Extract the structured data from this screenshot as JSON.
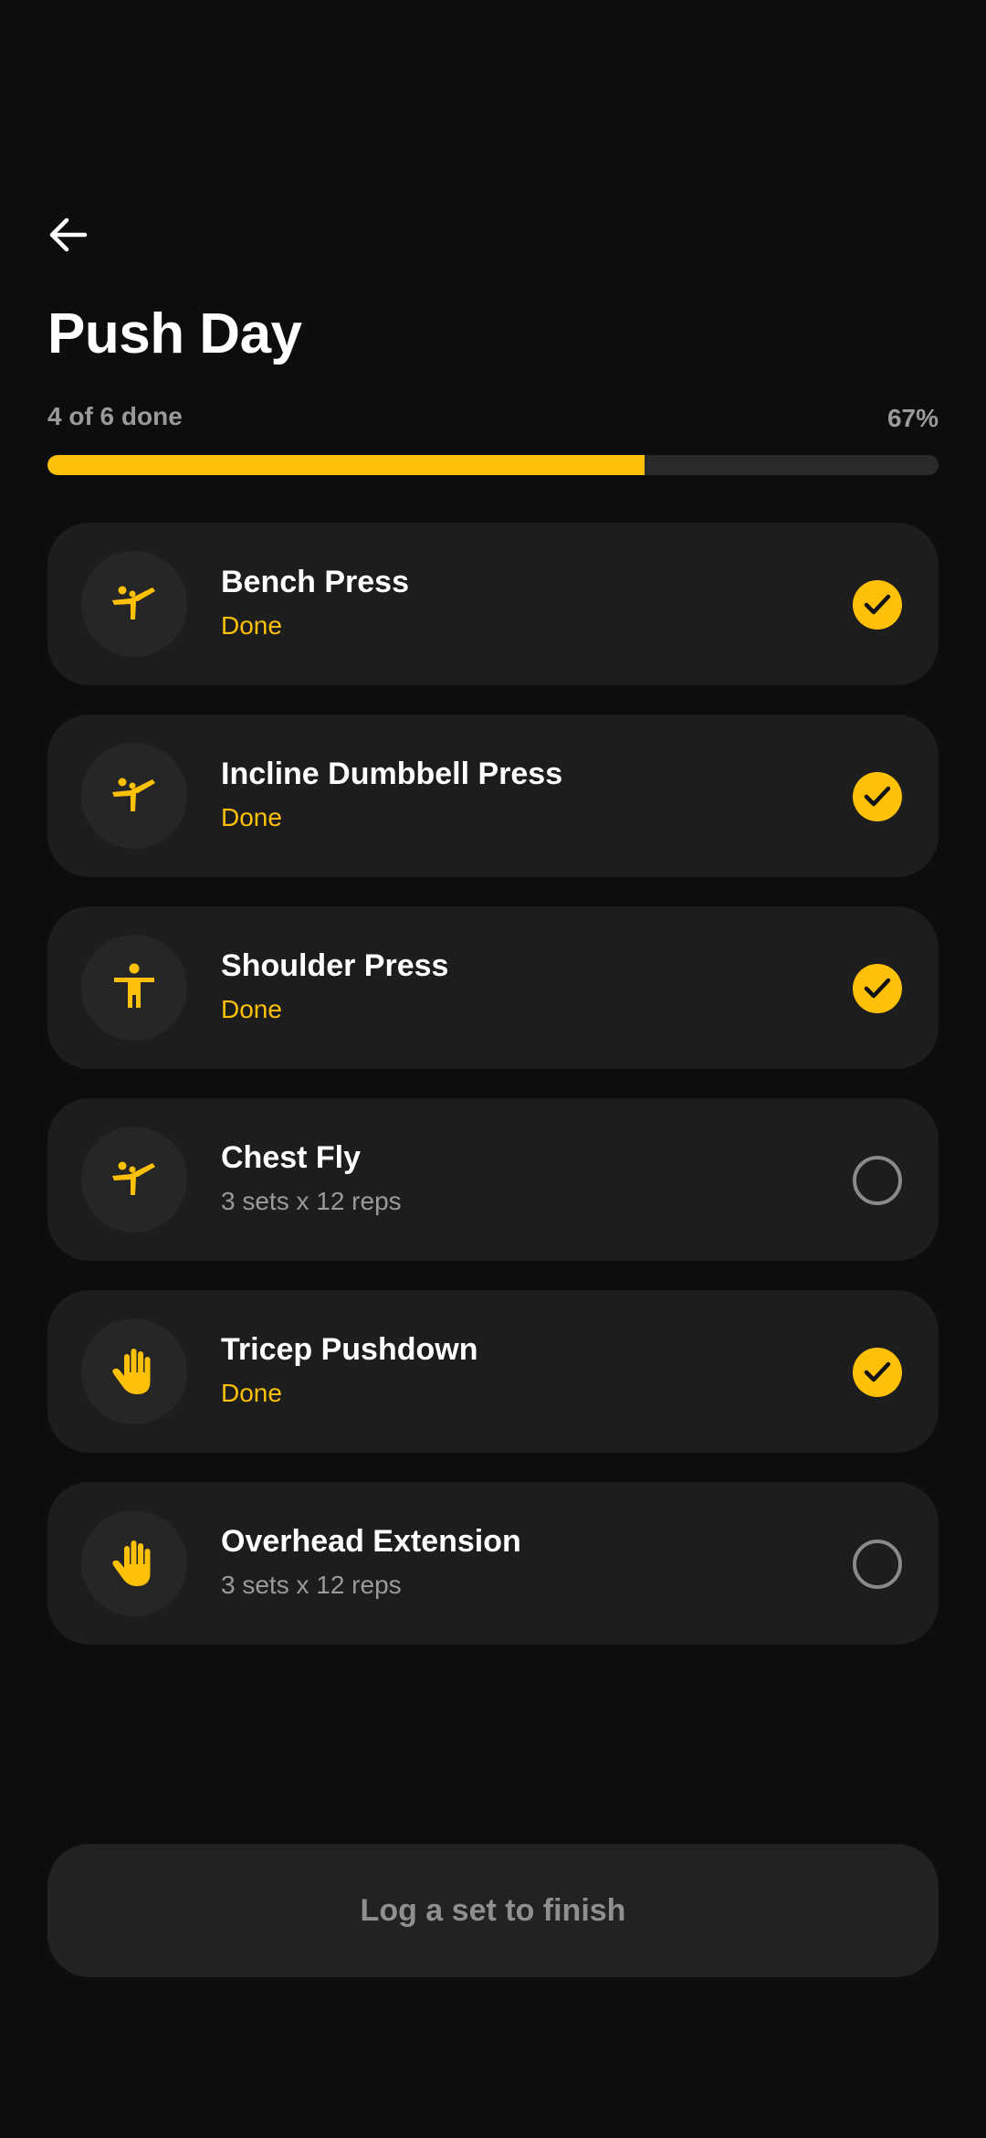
{
  "header": {
    "title": "Push Day"
  },
  "progress": {
    "count_label": "4 of 6 done",
    "percent_label": "67%",
    "fraction": 0.67
  },
  "colors": {
    "accent": "#ffc107",
    "card": "#1d1d1d",
    "background": "#0d0d0d",
    "muted": "#9a9a9a"
  },
  "exercises": [
    {
      "name": "Bench Press",
      "status": "Done",
      "done": true,
      "icon": "martial-arts-kick-icon"
    },
    {
      "name": "Incline Dumbbell Press",
      "status": "Done",
      "done": true,
      "icon": "martial-arts-kick-icon"
    },
    {
      "name": "Shoulder Press",
      "status": "Done",
      "done": true,
      "icon": "accessibility-person-icon"
    },
    {
      "name": "Chest Fly",
      "status": "3 sets x 12 reps",
      "done": false,
      "icon": "martial-arts-kick-icon"
    },
    {
      "name": "Tricep Pushdown",
      "status": "Done",
      "done": true,
      "icon": "hand-icon"
    },
    {
      "name": "Overhead Extension",
      "status": "3 sets x 12 reps",
      "done": false,
      "icon": "hand-icon"
    }
  ],
  "footer": {
    "finish_label": "Log a set to finish"
  }
}
